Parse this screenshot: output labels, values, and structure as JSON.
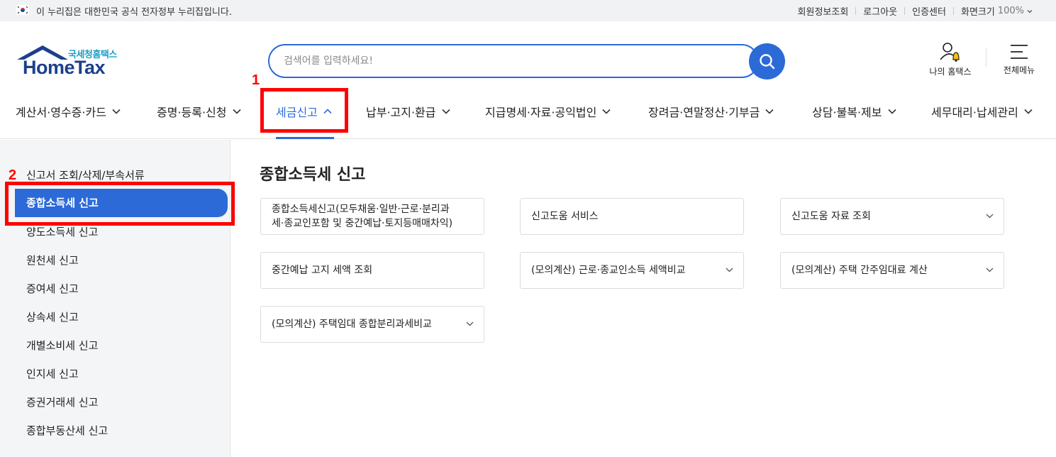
{
  "gov_strip": {
    "notice": "이 누리집은 대한민국 공식 전자정부 누리집입니다.",
    "links": [
      "회원정보조회",
      "로그아웃",
      "인증센터",
      "화면크기"
    ],
    "zoom": "100%"
  },
  "logo": {
    "kor": "국세청홈택스",
    "eng": "HomeTax"
  },
  "search": {
    "placeholder": "검색어를 입력하세요!"
  },
  "header": {
    "my_hometax": "나의 홈택스",
    "all_menu": "전체메뉴"
  },
  "gnb": {
    "items": [
      "계산서·영수증·카드",
      "증명·등록·신청",
      "세금신고",
      "납부·고지·환급",
      "지급명세·자료·공익법인",
      "장려금·연말정산·기부금",
      "상담·불복·제보",
      "세무대리·납세관리"
    ],
    "active_index": 2
  },
  "annotations": {
    "n1": "1",
    "n2": "2"
  },
  "sidebar": {
    "items": [
      "신고서 조회/삭제/부속서류",
      "종합소득세 신고",
      "양도소득세 신고",
      "원천세 신고",
      "증여세 신고",
      "상속세 신고",
      "개별소비세 신고",
      "인지세 신고",
      "증권거래세 신고",
      "종합부동산세 신고"
    ],
    "active_index": 1
  },
  "main": {
    "title": "종합소득세 신고",
    "cards": [
      {
        "line1": "종합소득세신고(모두채움·일반·근로·분리과",
        "line2": "세·종교인포함 및 중간예납·토지등매매차익)",
        "dropdown": false
      },
      {
        "line1": "신고도움 서비스",
        "dropdown": false
      },
      {
        "line1": "신고도움 자료 조회",
        "dropdown": true
      },
      {
        "line1": "중간예납 고지 세액 조회",
        "dropdown": false
      },
      {
        "line1": "(모의계산) 근로·종교인소득 세액비교",
        "dropdown": true
      },
      {
        "line1": "(모의계산) 주택 간주임대료 계산",
        "dropdown": true
      },
      {
        "line1": "(모의계산) 주택임대 종합분리과세비교",
        "dropdown": true
      }
    ]
  },
  "colors": {
    "accent": "#2c6ad8",
    "highlight": "#ff0000",
    "logo_navy": "#1d3f8c",
    "logo_teal": "#1a9ec8"
  }
}
